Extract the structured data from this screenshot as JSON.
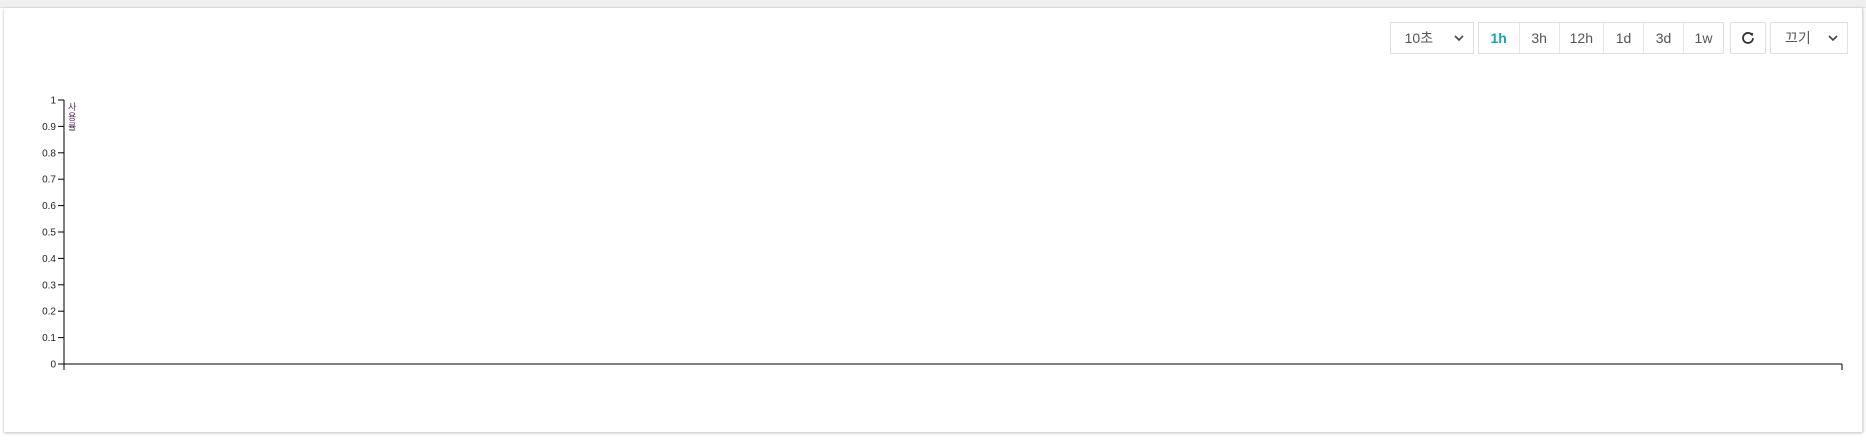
{
  "toolbar": {
    "interval_select": {
      "value": "10초"
    },
    "ranges": [
      {
        "label": "1h",
        "active": true
      },
      {
        "label": "3h",
        "active": false
      },
      {
        "label": "12h",
        "active": false
      },
      {
        "label": "1d",
        "active": false
      },
      {
        "label": "3d",
        "active": false
      },
      {
        "label": "1w",
        "active": false
      }
    ],
    "refresh_icon": "refresh-icon",
    "state_select": {
      "value": "끄기"
    }
  },
  "chart_data": {
    "type": "line",
    "series": [
      {
        "values": []
      }
    ],
    "ylim": [
      0,
      1
    ],
    "yticks": [
      "0",
      "0.1",
      "0.2",
      "0.3",
      "0.4",
      "0.5",
      "0.6",
      "0.7",
      "0.8",
      "0.9",
      "1"
    ],
    "grid": false,
    "legend_text_lines": [
      "사",
      "용",
      "률"
    ]
  },
  "colors": {
    "accent": "#1aa3b4",
    "axis": "#000000",
    "legend": "#5a2d5a"
  }
}
